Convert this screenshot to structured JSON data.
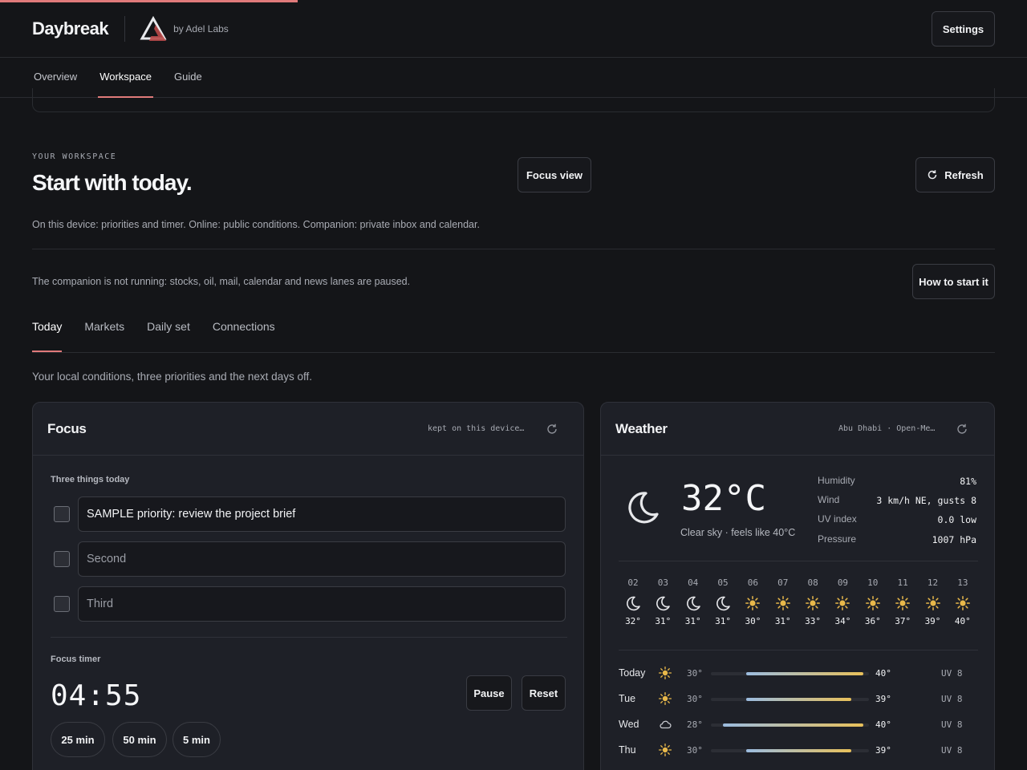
{
  "app": {
    "name": "Daybreak",
    "byline": "by Adel Labs",
    "settings_label": "Settings",
    "loading_progress": 0.29
  },
  "nav": {
    "tabs": [
      {
        "label": "Overview",
        "active": false
      },
      {
        "label": "Workspace",
        "active": true
      },
      {
        "label": "Guide",
        "active": false
      }
    ]
  },
  "hero": {
    "eyebrow": "YOUR WORKSPACE",
    "title": "Start with today.",
    "focus_view_label": "Focus view",
    "refresh_label": "Refresh",
    "description": "On this device: priorities and timer. Online: public conditions. Companion: private inbox and calendar."
  },
  "companion": {
    "message": "The companion is not running: stocks, oil, mail, calendar and news lanes are paused.",
    "button_label": "How to start it"
  },
  "sub_tabs": [
    {
      "label": "Today",
      "active": true
    },
    {
      "label": "Markets",
      "active": false
    },
    {
      "label": "Daily set",
      "active": false
    },
    {
      "label": "Connections",
      "active": false
    }
  ],
  "section_description": "Your local conditions, three priorities and the next days off.",
  "focus": {
    "title": "Focus",
    "meta": "kept on this device…",
    "priorities_label": "Three things today",
    "priorities": [
      {
        "value": "SAMPLE priority: review the project brief",
        "placeholder": ""
      },
      {
        "value": "",
        "placeholder": "Second"
      },
      {
        "value": "",
        "placeholder": "Third"
      }
    ],
    "timer_label": "Focus timer",
    "timer_value": "04:55",
    "pause_label": "Pause",
    "reset_label": "Reset",
    "presets": [
      "25 min",
      "50 min",
      "5 min"
    ]
  },
  "weather": {
    "title": "Weather",
    "meta": "Abu Dhabi · Open-Me…",
    "current": {
      "icon": "moon-icon",
      "temp": "32°C",
      "condition": "Clear sky · feels like 40°C"
    },
    "stats": [
      {
        "label": "Humidity",
        "value": "81%"
      },
      {
        "label": "Wind",
        "value": "3 km/h NE, gusts 8"
      },
      {
        "label": "UV index",
        "value": "0.0 low"
      },
      {
        "label": "Pressure",
        "value": "1007 hPa"
      }
    ],
    "hourly": [
      {
        "hour": "02",
        "icon": "moon-icon",
        "temp": "32°"
      },
      {
        "hour": "03",
        "icon": "moon-icon",
        "temp": "31°"
      },
      {
        "hour": "04",
        "icon": "moon-icon",
        "temp": "31°"
      },
      {
        "hour": "05",
        "icon": "moon-icon",
        "temp": "31°"
      },
      {
        "hour": "06",
        "icon": "sun-icon",
        "temp": "30°"
      },
      {
        "hour": "07",
        "icon": "sun-icon",
        "temp": "31°"
      },
      {
        "hour": "08",
        "icon": "sun-icon",
        "temp": "33°"
      },
      {
        "hour": "09",
        "icon": "sun-icon",
        "temp": "34°"
      },
      {
        "hour": "10",
        "icon": "sun-icon",
        "temp": "36°"
      },
      {
        "hour": "11",
        "icon": "sun-icon",
        "temp": "37°"
      },
      {
        "hour": "12",
        "icon": "sun-icon",
        "temp": "39°"
      },
      {
        "hour": "13",
        "icon": "sun-icon",
        "temp": "40°"
      }
    ],
    "daily": [
      {
        "day": "Today",
        "icon": "sun-icon",
        "low": "30°",
        "high": "40°",
        "uv": "UV 8",
        "range_lo": 30,
        "range_hi": 40
      },
      {
        "day": "Tue",
        "icon": "sun-icon",
        "low": "30°",
        "high": "39°",
        "uv": "UV 8",
        "range_lo": 30,
        "range_hi": 39
      },
      {
        "day": "Wed",
        "icon": "cloud-icon",
        "low": "28°",
        "high": "40°",
        "uv": "UV 8",
        "range_lo": 28,
        "range_hi": 40
      },
      {
        "day": "Thu",
        "icon": "sun-icon",
        "low": "30°",
        "high": "39°",
        "uv": "UV 8",
        "range_lo": 30,
        "range_hi": 39
      }
    ],
    "daily_scale": [
      27,
      40.5
    ]
  },
  "colors": {
    "accent": "#e07a7a",
    "sun": "#e8b84a",
    "background": "#141518",
    "card": "#1e2027"
  }
}
